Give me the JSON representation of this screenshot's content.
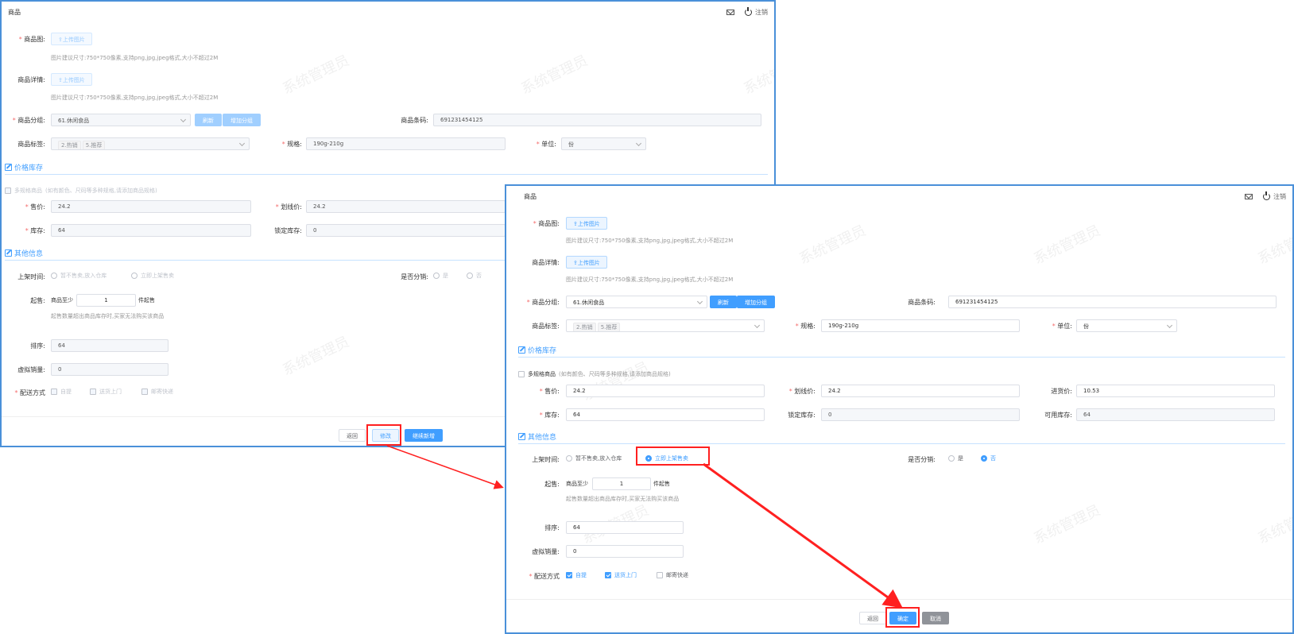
{
  "window_title": "商品",
  "logout_label": "注销",
  "watermark": "系统管理员",
  "form": {
    "product_image_label": "商品图:",
    "product_detail_label": "商品详情:",
    "upload_btn": "⇪上传图片",
    "upload_hint": "图片建议尺寸:750*750像素,支持png,jpg,jpeg格式,大小不超过2M",
    "category_label": "商品分组:",
    "category_value": "61.休闲食品",
    "refresh_btn": "刷新",
    "add_group_btn": "增加分组",
    "barcode_label": "商品条码:",
    "barcode_value": "691231454125",
    "tags_label": "商品标签:",
    "tags": [
      "2.热销",
      "5.推荐"
    ],
    "spec_label": "规格:",
    "spec_value": "190g-210g",
    "unit_label": "单位:",
    "unit_value": "份"
  },
  "price": {
    "section_title": "价格库存",
    "multi_spec_label": "多规格商品",
    "multi_spec_hint": "(如有颜色、尺码等多种规格,请添加商品规格)",
    "price_label": "售价:",
    "price_value": "24.2",
    "strike_label": "划线价:",
    "strike_value": "24.2",
    "cost_label": "进货价:",
    "cost_value": "10.53",
    "stock_label": "库存:",
    "stock_value": "64",
    "locked_label": "锁定库存:",
    "locked_value": "0",
    "available_label": "可用库存:",
    "available_value": "64"
  },
  "other": {
    "section_title": "其他信息",
    "shelf_label": "上架时间:",
    "shelf_opt1": "暂不售卖,放入仓库",
    "shelf_opt2": "立即上架售卖",
    "dist_label": "是否分销:",
    "dist_yes": "是",
    "dist_no": "否",
    "min_label": "起售:",
    "min_prefix": "商品至少",
    "min_value": "1",
    "min_suffix": "件起售",
    "min_hint": "起售数量超出商品库存时,买家无法购买该商品",
    "sort_label": "排序:",
    "sort_value": "64",
    "virtual_label": "虚拟销量:",
    "virtual_value": "0",
    "delivery_label": "配送方式",
    "delivery_opt1": "自提",
    "delivery_opt2": "送货上门",
    "delivery_opt3": "邮寄快递"
  },
  "footer": {
    "back_btn": "返回",
    "edit_btn": "修改",
    "continue_btn": "继续新增",
    "confirm_btn": "确定",
    "cancel_btn": "取消"
  }
}
